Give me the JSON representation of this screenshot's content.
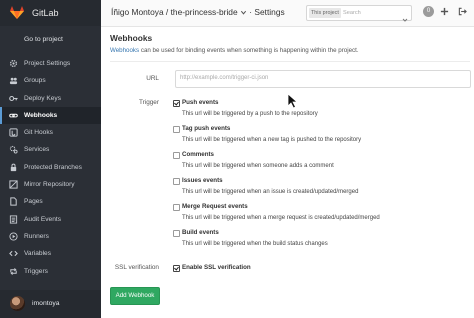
{
  "colors": {
    "sidebar_bg": "#2b2f36",
    "accent": "#5b9bd5",
    "link": "#3777b0",
    "success": "#2fa861",
    "brand": "#e24329"
  },
  "sidebar": {
    "brand": "GitLab",
    "back_link": "Go to project",
    "items": [
      {
        "label": "Project Settings",
        "icon": "gear-icon"
      },
      {
        "label": "Groups",
        "icon": "group-icon"
      },
      {
        "label": "Deploy Keys",
        "icon": "key-icon"
      },
      {
        "label": "Webhooks",
        "icon": "link-icon",
        "active": true
      },
      {
        "label": "Git Hooks",
        "icon": "git-hook-icon"
      },
      {
        "label": "Services",
        "icon": "cogs-icon"
      },
      {
        "label": "Protected Branches",
        "icon": "lock-icon"
      },
      {
        "label": "Mirror Repository",
        "icon": "mirror-icon"
      },
      {
        "label": "Pages",
        "icon": "file-icon"
      },
      {
        "label": "Audit Events",
        "icon": "list-icon"
      },
      {
        "label": "Runners",
        "icon": "play-icon"
      },
      {
        "label": "Variables",
        "icon": "code-icon"
      },
      {
        "label": "Triggers",
        "icon": "retweet-icon"
      }
    ],
    "user": "imontoya"
  },
  "header": {
    "title": "Íñigo Montoya / the-princess-bride",
    "section": "· Settings",
    "search_scope": "This project",
    "search_placeholder": "Search",
    "todo_count": "0"
  },
  "main": {
    "heading": "Webhooks",
    "lead_link": "Webhooks",
    "lead_text": " can be used for binding events when something is happening within the project.",
    "url_label": "URL",
    "url_placeholder": "http://example.com/trigger-ci.json",
    "trigger_label": "Trigger",
    "triggers": [
      {
        "title": "Push events",
        "desc": "This url will be triggered by a push to the repository",
        "checked": true
      },
      {
        "title": "Tag push events",
        "desc": "This url will be triggered when a new tag is pushed to the repository",
        "checked": false
      },
      {
        "title": "Comments",
        "desc": "This url will be triggered when someone adds a comment",
        "checked": false
      },
      {
        "title": "Issues events",
        "desc": "This url will be triggered when an issue is created/updated/merged",
        "checked": false
      },
      {
        "title": "Merge Request events",
        "desc": "This url will be triggered when a merge request is created/updated/merged",
        "checked": false
      },
      {
        "title": "Build events",
        "desc": "This url will be triggered when the build status changes",
        "checked": false
      }
    ],
    "ssl_label": "SSL verification",
    "ssl_option": "Enable SSL verification",
    "ssl_checked": true,
    "submit_label": "Add Webhook"
  }
}
